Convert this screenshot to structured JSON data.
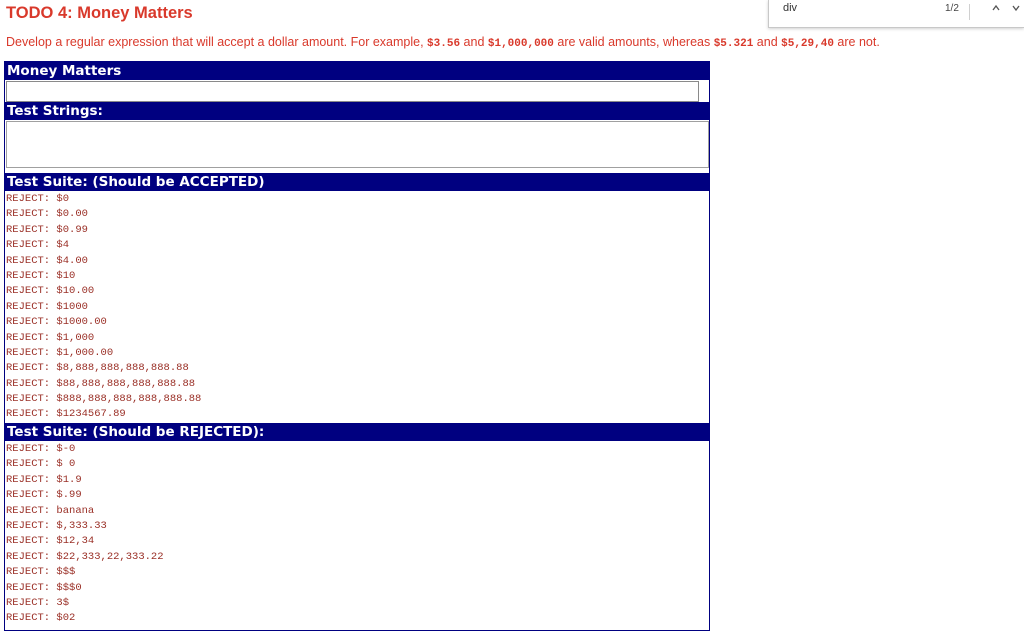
{
  "heading": {
    "title": "TODO 4: Money Matters"
  },
  "description": {
    "before": "Develop a regular expression that will accept a dollar amount. For example, ",
    "ex1": "$3.56",
    "and1": " and ",
    "ex2": "$1,000,000",
    "middle": " are valid amounts, whereas ",
    "ex3": "$5.321",
    "and2": " and ",
    "ex4": "$5,29,40",
    "after": " are not."
  },
  "find_bar": {
    "query": "div",
    "count": "1/2"
  },
  "panel": {
    "money_header": "Money Matters",
    "money_input_value": "",
    "test_strings_header": "Test Strings:",
    "test_strings_value": "",
    "accepted_header": "Test Suite: (Should be ACCEPTED)",
    "rejected_header": "Test Suite: (Should be REJECTED):"
  },
  "accepted": [
    {
      "status": "REJECT:",
      "value": "$0"
    },
    {
      "status": "REJECT:",
      "value": "$0.00"
    },
    {
      "status": "REJECT:",
      "value": "$0.99"
    },
    {
      "status": "REJECT:",
      "value": "$4"
    },
    {
      "status": "REJECT:",
      "value": "$4.00"
    },
    {
      "status": "REJECT:",
      "value": "$10"
    },
    {
      "status": "REJECT:",
      "value": "$10.00"
    },
    {
      "status": "REJECT:",
      "value": "$1000"
    },
    {
      "status": "REJECT:",
      "value": "$1000.00"
    },
    {
      "status": "REJECT:",
      "value": "$1,000"
    },
    {
      "status": "REJECT:",
      "value": "$1,000.00"
    },
    {
      "status": "REJECT:",
      "value": "$8,888,888,888,888.88"
    },
    {
      "status": "REJECT:",
      "value": "$88,888,888,888,888.88"
    },
    {
      "status": "REJECT:",
      "value": "$888,888,888,888,888.88"
    },
    {
      "status": "REJECT:",
      "value": "$1234567.89"
    }
  ],
  "rejected": [
    {
      "status": "REJECT:",
      "value": "$-0"
    },
    {
      "status": "REJECT:",
      "value": "$ 0"
    },
    {
      "status": "REJECT:",
      "value": "$1.9"
    },
    {
      "status": "REJECT:",
      "value": "$.99"
    },
    {
      "status": "REJECT:",
      "value": "banana"
    },
    {
      "status": "REJECT:",
      "value": "$,333.33"
    },
    {
      "status": "REJECT:",
      "value": "$12,34"
    },
    {
      "status": "REJECT:",
      "value": "$22,333,22,333.22"
    },
    {
      "status": "REJECT:",
      "value": "$$$"
    },
    {
      "status": "REJECT:",
      "value": "$$$0"
    },
    {
      "status": "REJECT:",
      "value": "3$"
    },
    {
      "status": "REJECT:",
      "value": "$02"
    }
  ],
  "icons": {
    "find_prev": "chevron-up-icon",
    "find_next": "chevron-down-icon"
  },
  "colors": {
    "title_red": "#d9392b",
    "header_navy": "#000080",
    "entry_red": "#9a2f26"
  }
}
